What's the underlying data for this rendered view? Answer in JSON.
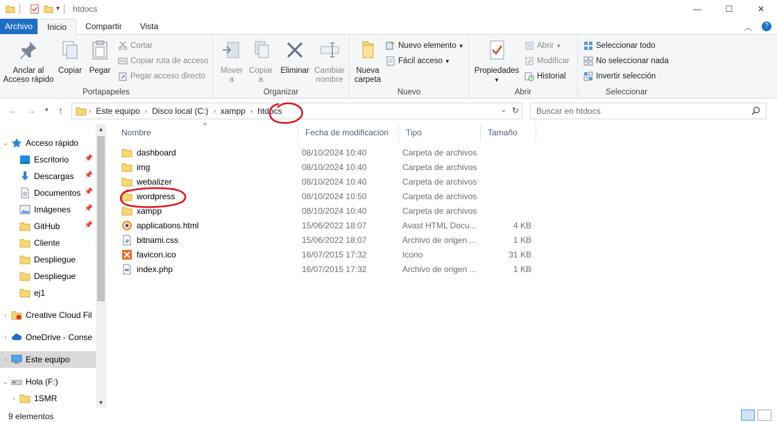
{
  "window": {
    "title": "htdocs",
    "minimize": "—",
    "maximize": "☐",
    "close": "✕"
  },
  "tabs": {
    "file": "Archivo",
    "home": "Inicio",
    "share": "Compartir",
    "view": "Vista"
  },
  "ribbon": {
    "portapapeles": {
      "label": "Portapapeles",
      "pin_quick_line1": "Anclar al",
      "pin_quick_line2": "Acceso rápido",
      "copy": "Copiar",
      "paste": "Pegar",
      "cut": "Cortar",
      "copy_path": "Copiar ruta de acceso",
      "paste_shortcut": "Pegar acceso directo"
    },
    "organizar": {
      "label": "Organizar",
      "move_line1": "Mover",
      "move_line2": "a",
      "copy_to_line1": "Copiar",
      "copy_to_line2": "a",
      "delete": "Eliminar",
      "rename_line1": "Cambiar",
      "rename_line2": "nombre"
    },
    "nuevo": {
      "label": "Nuevo",
      "new_folder_line1": "Nueva",
      "new_folder_line2": "carpeta",
      "new_item": "Nuevo elemento",
      "easy_access": "Fácil acceso"
    },
    "abrir": {
      "label": "Abrir",
      "properties": "Propiedades",
      "open": "Abrir",
      "edit": "Modificar",
      "history": "Historial"
    },
    "seleccionar": {
      "label": "Seleccionar",
      "select_all": "Seleccionar todo",
      "select_none": "No seleccionar nada",
      "invert": "Invertir selección"
    }
  },
  "address": {
    "crumbs": [
      "Este equipo",
      "Disco local (C:)",
      "xampp",
      "htdocs"
    ],
    "search_placeholder": "Buscar en htdocs"
  },
  "nav": {
    "quick_access": "Acceso rápido",
    "items": [
      {
        "label": "Escritorio",
        "pinned": true
      },
      {
        "label": "Descargas",
        "pinned": true
      },
      {
        "label": "Documentos",
        "pinned": true
      },
      {
        "label": "Imágenes",
        "pinned": true
      },
      {
        "label": "GitHub",
        "pinned": true
      },
      {
        "label": "Cliente",
        "pinned": false
      },
      {
        "label": "Despliegue",
        "pinned": false
      },
      {
        "label": "Despliegue",
        "pinned": false
      },
      {
        "label": "ej1",
        "pinned": false
      }
    ],
    "creative_cloud": "Creative Cloud Fil",
    "onedrive": "OneDrive - Conse",
    "this_pc": "Este equipo",
    "drive_f": "Hola (F:)",
    "folder_1smr": "1SMR"
  },
  "columns": {
    "name": "Nombre",
    "date": "Fecha de modificación",
    "type": "Tipo",
    "size": "Tamaño"
  },
  "files": [
    {
      "name": "dashboard",
      "date": "08/10/2024 10:40",
      "type": "Carpeta de archivos",
      "size": "",
      "icon": "folder-icon"
    },
    {
      "name": "img",
      "date": "08/10/2024 10:40",
      "type": "Carpeta de archivos",
      "size": "",
      "icon": "folder-icon"
    },
    {
      "name": "webalizer",
      "date": "08/10/2024 10:40",
      "type": "Carpeta de archivos",
      "size": "",
      "icon": "folder-icon"
    },
    {
      "name": "wordpress",
      "date": "08/10/2024 10:50",
      "type": "Carpeta de archivos",
      "size": "",
      "icon": "folder-icon"
    },
    {
      "name": "xampp",
      "date": "08/10/2024 10:40",
      "type": "Carpeta de archivos",
      "size": "",
      "icon": "folder-icon"
    },
    {
      "name": "applications.html",
      "date": "15/06/2022 18:07",
      "type": "Avast HTML Docu...",
      "size": "4 KB",
      "icon": "avast-html-icon"
    },
    {
      "name": "bitnami.css",
      "date": "15/06/2022 18:07",
      "type": "Archivo de origen ...",
      "size": "1 KB",
      "icon": "css-file-icon"
    },
    {
      "name": "favicon.ico",
      "date": "16/07/2015 17:32",
      "type": "Icono",
      "size": "31 KB",
      "icon": "ico-file-icon"
    },
    {
      "name": "index.php",
      "date": "16/07/2015 17:32",
      "type": "Archivo de origen ...",
      "size": "1 KB",
      "icon": "php-file-icon"
    }
  ],
  "status": {
    "count": "9 elementos"
  }
}
